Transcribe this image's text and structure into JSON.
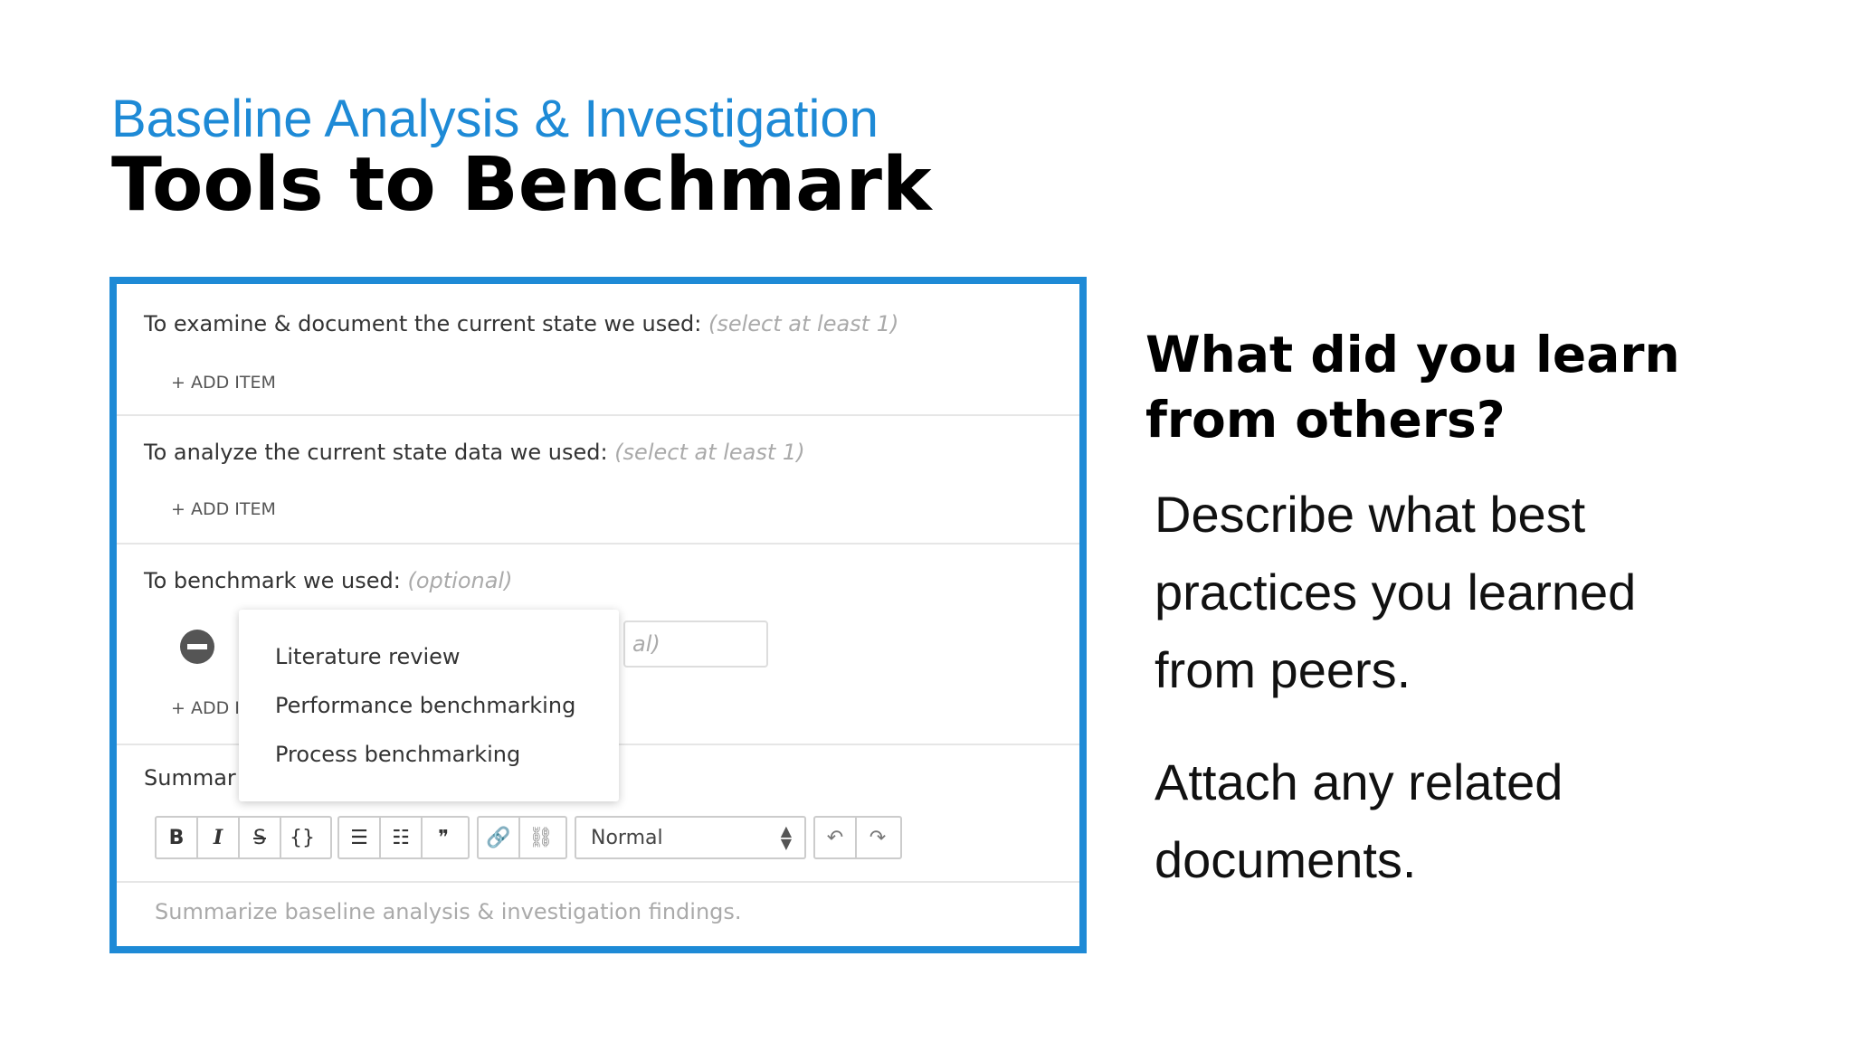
{
  "slide": {
    "subtitle": "Baseline Analysis & Investigation",
    "title": "Tools to Benchmark"
  },
  "form": {
    "section1": {
      "label": "To examine & document the current state we used:",
      "hint": "(select at least 1)",
      "add": "+ ADD ITEM"
    },
    "section2": {
      "label": "To analyze the current state data we used:",
      "hint": "(select at least 1)",
      "add": "+ ADD ITEM"
    },
    "section3": {
      "label": "To benchmark we used:",
      "hint": "(optional)",
      "add": "+ ADD I",
      "field_hint": "al)"
    },
    "dropdown": [
      "Literature review",
      "Performance benchmarking",
      "Process benchmarking"
    ],
    "summary": {
      "label": "Summar",
      "placeholder": "Summarize baseline analysis & investigation findings.",
      "format_select": "Normal"
    },
    "toolbar": {
      "bold": "B",
      "italic": "I",
      "strike": "S",
      "code": "{}",
      "bullets": "☰",
      "numbers": "☷",
      "quote": "❞",
      "link": "🔗",
      "unlink": "⛓",
      "undo": "↶",
      "redo": "↷"
    }
  },
  "side": {
    "heading": [
      "What did you learn",
      "from others?"
    ],
    "para1": [
      "Describe what best",
      "practices you learned",
      "from peers."
    ],
    "para2": [
      "Attach any related",
      "documents."
    ]
  }
}
